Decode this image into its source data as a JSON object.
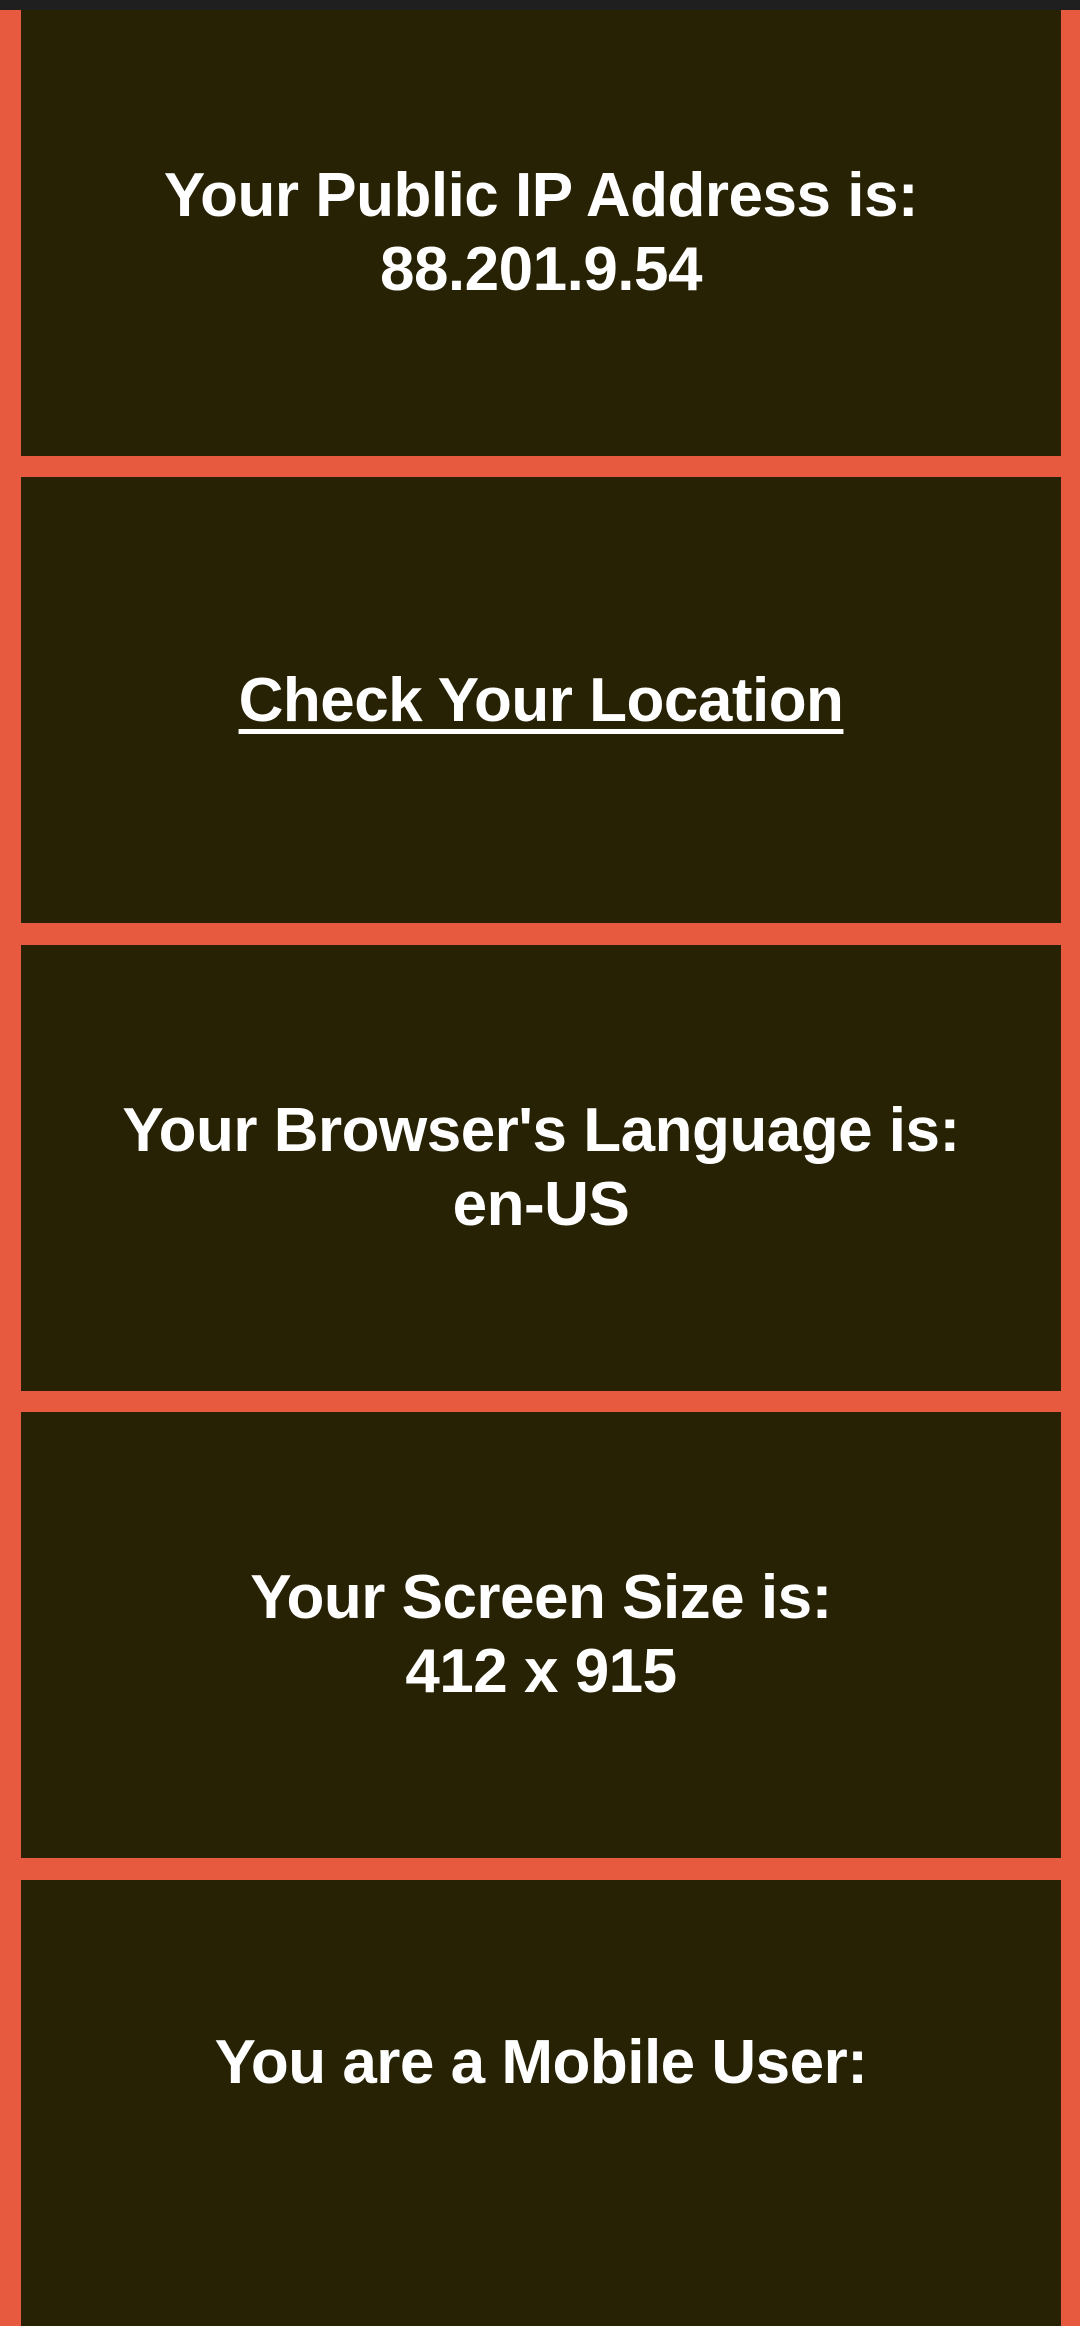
{
  "colors": {
    "background": "#e85a40",
    "card": "#272203",
    "text": "#ffffff",
    "status_strip": "#1f1f1f"
  },
  "cards": {
    "ip": {
      "label": "Your Public IP Address is:",
      "value": "88.201.9.54"
    },
    "location": {
      "link_text": "Check Your Location"
    },
    "language": {
      "label": "Your Browser's Language is:",
      "value": "en-US"
    },
    "screen": {
      "label": "Your Screen Size is:",
      "value": "412 x 915"
    },
    "mobile": {
      "label": "You are a Mobile User:"
    }
  }
}
